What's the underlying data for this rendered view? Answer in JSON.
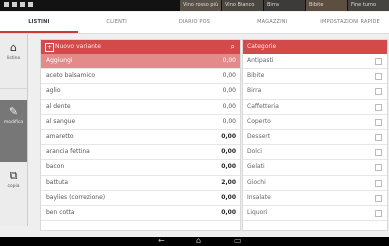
{
  "status_bar": {
    "icons": [
      "notification-icon",
      "notification-icon",
      "notification-icon",
      "notification-icon"
    ]
  },
  "thumbnails": [
    "Vino rosso più",
    "Vino Bianco",
    "Birra",
    "Bibite",
    "Fine turno"
  ],
  "tabs": [
    {
      "label": "LISTINI",
      "active": true
    },
    {
      "label": "CLIENTI",
      "active": false
    },
    {
      "label": "DIARIO POS",
      "active": false
    },
    {
      "label": "MAGAZZINI",
      "active": false
    },
    {
      "label": "IMPOSTAZIONI RAPIDE",
      "active": false
    }
  ],
  "sidebar": {
    "b1": {
      "icon": "home-icon",
      "label": "listino"
    },
    "b2": {
      "icon": "edit-icon",
      "label": "modifica"
    },
    "b3": {
      "icon": "copy-icon",
      "label": "copia"
    }
  },
  "search": {
    "placeholder": "Nuovo variante"
  },
  "variants": [
    {
      "name": "Aggiungi",
      "price": "0,00",
      "bold": false,
      "selected": true
    },
    {
      "name": "aceto balsamico",
      "price": "0,00",
      "bold": false,
      "selected": false
    },
    {
      "name": "aglio",
      "price": "0,00",
      "bold": false,
      "selected": false
    },
    {
      "name": "al dente",
      "price": "0,00",
      "bold": false,
      "selected": false
    },
    {
      "name": "al sangue",
      "price": "0,00",
      "bold": false,
      "selected": false
    },
    {
      "name": "amaretto",
      "price": "0,00",
      "bold": true,
      "selected": false
    },
    {
      "name": "arancia fettina",
      "price": "0,00",
      "bold": true,
      "selected": false
    },
    {
      "name": "bacon",
      "price": "0,00",
      "bold": true,
      "selected": false
    },
    {
      "name": "battuta",
      "price": "2,00",
      "bold": true,
      "selected": false
    },
    {
      "name": "baylies (correzione)",
      "price": "0,00",
      "bold": true,
      "selected": false
    },
    {
      "name": "ben cotta",
      "price": "0,00",
      "bold": true,
      "selected": false
    }
  ],
  "categories_header": "Categorie",
  "categories": [
    "Antipasti",
    "Bibite",
    "Birra",
    "Caffetteria",
    "Coperto",
    "Dessert",
    "Dolci",
    "Gelati",
    "Giochi",
    "Insalate",
    "Liquori"
  ],
  "nav": {
    "back": "←",
    "home": "⌂",
    "recent": "▭"
  }
}
